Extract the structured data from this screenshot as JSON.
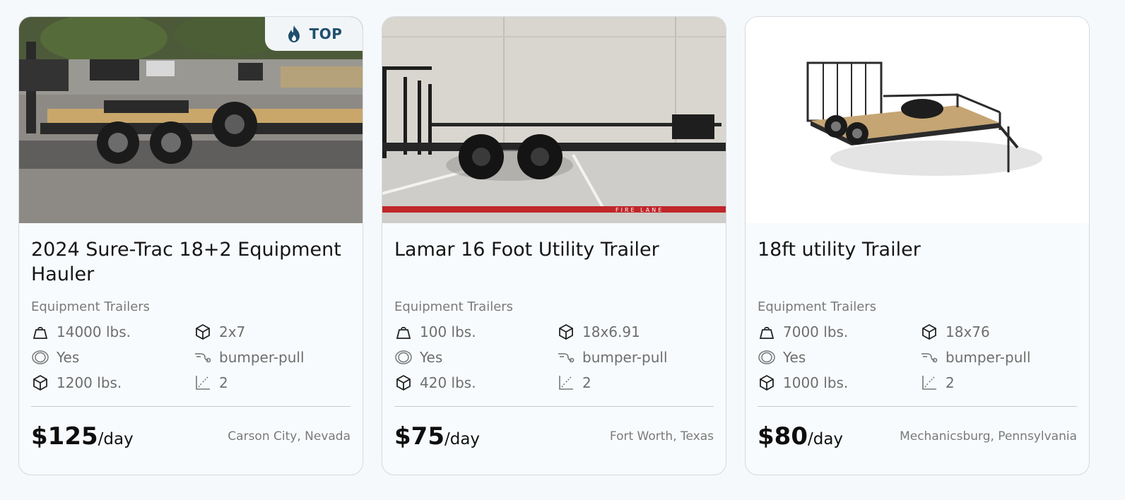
{
  "listings": [
    {
      "badge": "TOP",
      "title": "2024 Sure-Trac 18+2 Equipment Hauler",
      "category": "Equipment Trailers",
      "specs": {
        "weight": "14000 lbs.",
        "size": "2x7",
        "brakes": "Yes",
        "hitch": "bumper-pull",
        "payload": "1200 lbs.",
        "axles": "2"
      },
      "price": "$125",
      "price_unit": "/day",
      "location": "Carson City, Nevada"
    },
    {
      "title": "Lamar 16 Foot Utility Trailer",
      "category": "Equipment Trailers",
      "specs": {
        "weight": "100 lbs.",
        "size": "18x6.91",
        "brakes": "Yes",
        "hitch": "bumper-pull",
        "payload": "420 lbs.",
        "axles": "2"
      },
      "price": "$75",
      "price_unit": "/day",
      "location": "Fort Worth, Texas",
      "image_text": "FIRE LANE"
    },
    {
      "title": "18ft utility Trailer",
      "category": "Equipment Trailers",
      "specs": {
        "weight": "7000 lbs.",
        "size": "18x76",
        "brakes": "Yes",
        "hitch": "bumper-pull",
        "payload": "1000 lbs.",
        "axles": "2"
      },
      "price": "$80",
      "price_unit": "/day",
      "location": "Mechanicsburg, Pennsylvania"
    }
  ],
  "icons": {
    "weight": "weight-icon",
    "size": "box-icon",
    "brakes": "brakes-icon",
    "hitch": "hitch-icon",
    "payload": "box-icon",
    "axles": "axle-chart-icon",
    "badge": "flame-icon"
  },
  "colors": {
    "badge_text": "#1f4f6e",
    "badge_bg": "#f2f5f7",
    "card_border": "#d6d9dd",
    "muted_text": "#7a7a7a"
  }
}
